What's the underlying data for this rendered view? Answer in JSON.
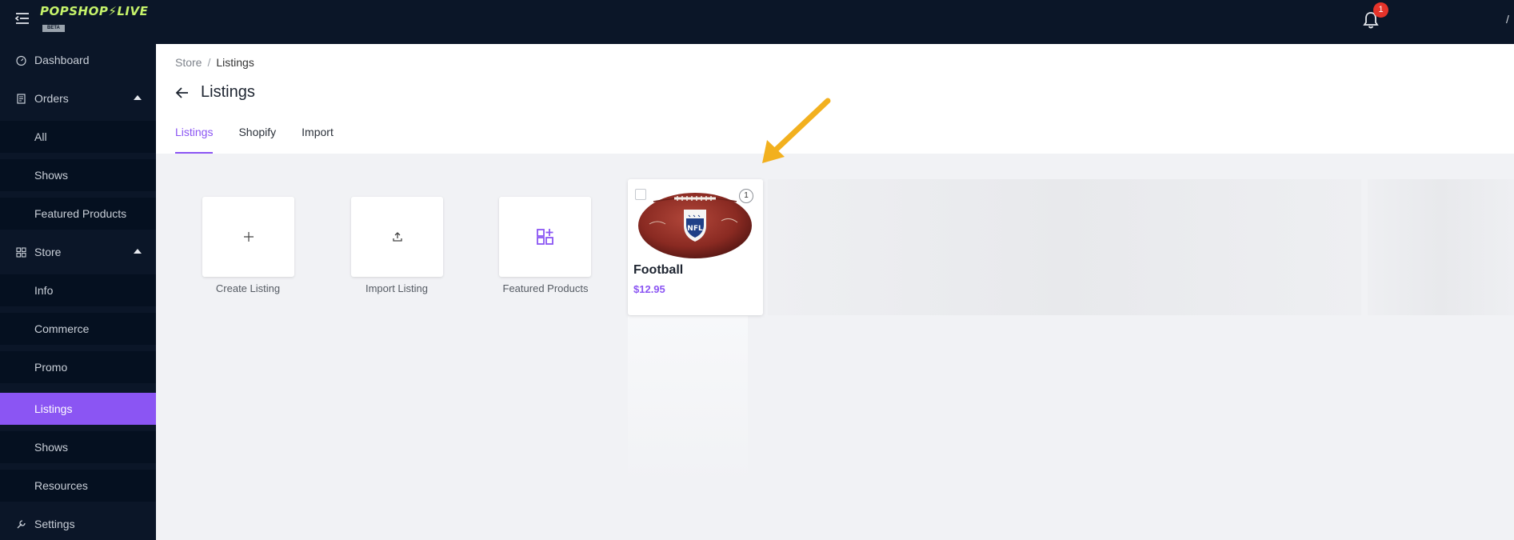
{
  "brand": {
    "logo_text": "POPSHOP⚡LIVE",
    "beta_label": "BETA"
  },
  "notifications": {
    "count": "1"
  },
  "sidebar": {
    "items": [
      {
        "label": "Dashboard"
      },
      {
        "label": "Orders"
      },
      {
        "label": "All"
      },
      {
        "label": "Shows"
      },
      {
        "label": "Featured Products"
      },
      {
        "label": "Store"
      },
      {
        "label": "Info"
      },
      {
        "label": "Commerce"
      },
      {
        "label": "Promo"
      },
      {
        "label": "Listings"
      },
      {
        "label": "Shows"
      },
      {
        "label": "Resources"
      },
      {
        "label": "Settings"
      }
    ]
  },
  "breadcrumb": {
    "parent": "Store",
    "separator": "/",
    "current": "Listings"
  },
  "page": {
    "title": "Listings"
  },
  "tabs": [
    {
      "label": "Listings",
      "active": true
    },
    {
      "label": "Shopify",
      "active": false
    },
    {
      "label": "Import",
      "active": false
    }
  ],
  "actions": {
    "create": {
      "label": "Create Listing",
      "icon": "plus-icon"
    },
    "import": {
      "label": "Import Listing",
      "icon": "upload-icon"
    },
    "featured": {
      "label": "Featured Products",
      "icon": "grid-plus-icon"
    }
  },
  "listing": {
    "name": "Football",
    "price": "$12.95",
    "quantity": "1",
    "image": "nfl-football-image"
  },
  "colors": {
    "accent": "#8b55f3",
    "topbar": "#0b1628",
    "badge": "#e5332a",
    "arrow": "#f2b01e"
  }
}
